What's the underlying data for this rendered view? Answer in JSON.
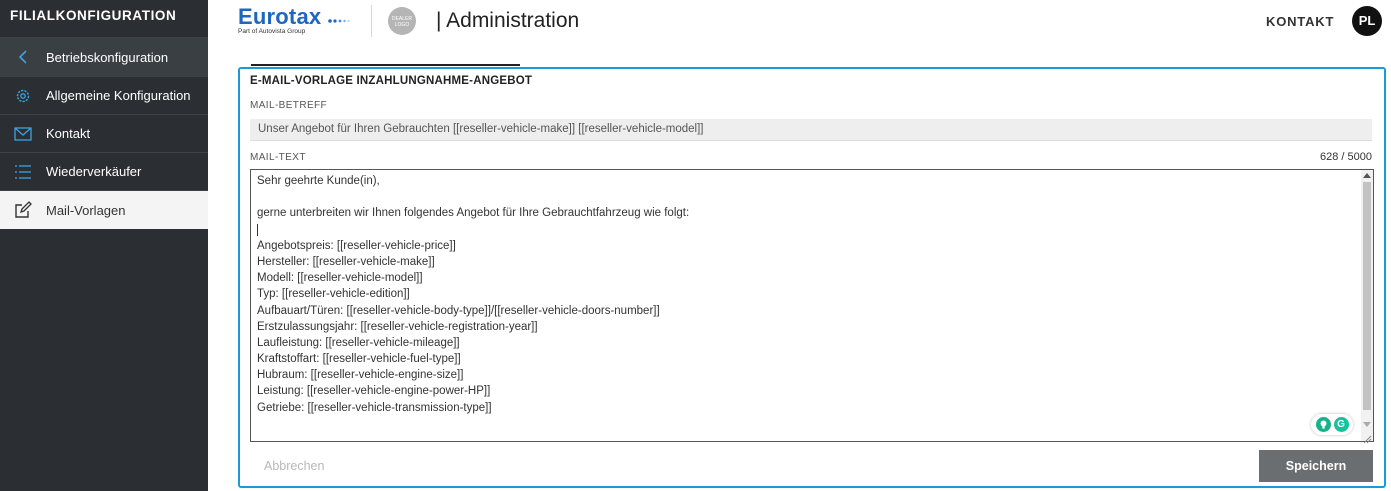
{
  "sidebar": {
    "title": "FILIALKONFIGURATION",
    "items": [
      {
        "label": "Betriebskonfiguration",
        "icon": "chevron-left-icon"
      },
      {
        "label": "Allgemeine Konfiguration",
        "icon": "gear-icon"
      },
      {
        "label": "Kontakt",
        "icon": "envelope-icon"
      },
      {
        "label": "Wiederverkäufer",
        "icon": "list-icon"
      },
      {
        "label": "Mail-Vorlagen",
        "icon": "edit-icon"
      }
    ]
  },
  "header": {
    "brand": "Eurotax",
    "brand_sub": "Part of Autovista Group",
    "dealer_logo": "DEALER LOGO",
    "title": "| Administration",
    "contact": "KONTAKT",
    "avatar_initials": "PL"
  },
  "form": {
    "title": "E-MAIL-VORLAGE INZAHLUNGNAHME-ANGEBOT",
    "subject_label": "MAIL-BETREFF",
    "subject_value": "Unser Angebot für Ihren Gebrauchten [[reseller-vehicle-make]] [[reseller-vehicle-model]]",
    "text_label": "MAIL-TEXT",
    "counter": "628 / 5000",
    "text_lines": [
      "Sehr geehrte Kunde(in),",
      "",
      "gerne unterbreiten wir Ihnen folgendes Angebot für Ihre Gebrauchtfahrzeug wie folgt:",
      "",
      "Angebotspreis: [[reseller-vehicle-price]]",
      "Hersteller: [[reseller-vehicle-make]]",
      "Modell: [[reseller-vehicle-model]]",
      "Typ: [[reseller-vehicle-edition]]",
      "Aufbauart/Türen: [[reseller-vehicle-body-type]]/[[reseller-vehicle-doors-number]]",
      "Erstzulassungsjahr: [[reseller-vehicle-registration-year]]",
      "Laufleistung: [[reseller-vehicle-mileage]]",
      "Kraftstoffart: [[reseller-vehicle-fuel-type]]",
      "Hubraum: [[reseller-vehicle-engine-size]]",
      "Leistung: [[reseller-vehicle-engine-power-HP]]",
      "Getriebe: [[reseller-vehicle-transmission-type]]"
    ],
    "cancel_label": "Abbrechen",
    "save_label": "Speichern"
  },
  "colors": {
    "sidebar_bg": "#2b2f33",
    "accent": "#1a9ad6",
    "brand": "#1f66c1",
    "save_bg": "#6b6e70"
  }
}
